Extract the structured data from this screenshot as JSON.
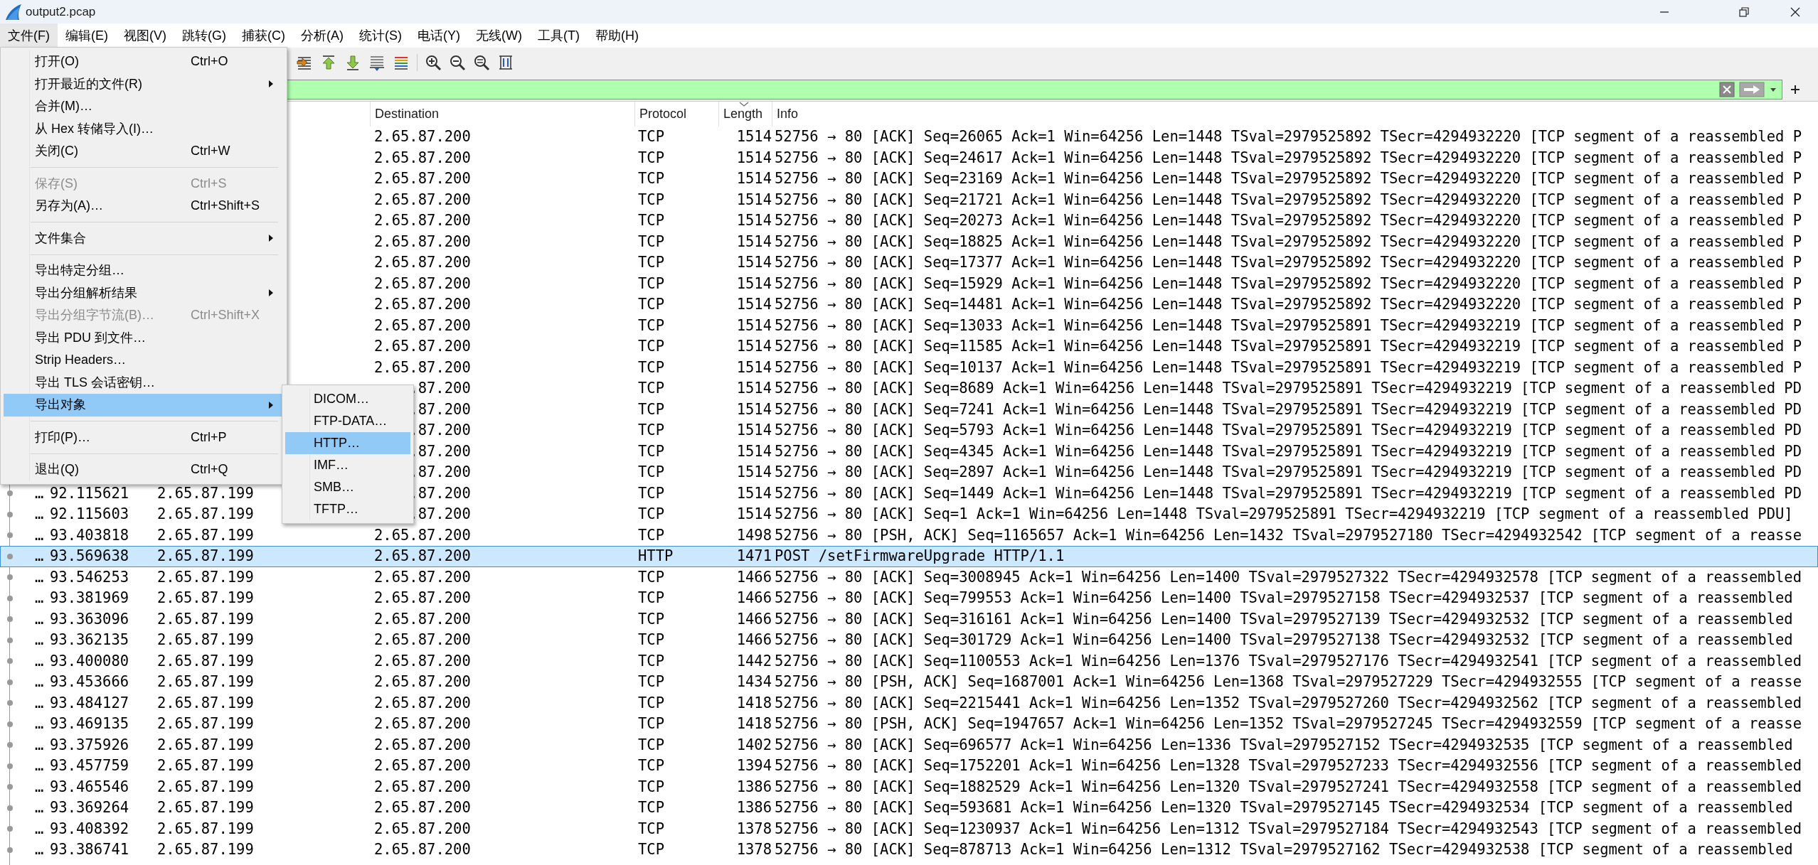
{
  "window": {
    "title": "output2.pcap"
  },
  "menu_bar": [
    {
      "label": "文件(F)",
      "selected": true
    },
    {
      "label": "编辑(E)",
      "selected": false
    },
    {
      "label": "视图(V)",
      "selected": false
    },
    {
      "label": "跳转(G)",
      "selected": false
    },
    {
      "label": "捕获(C)",
      "selected": false
    },
    {
      "label": "分析(A)",
      "selected": false
    },
    {
      "label": "统计(S)",
      "selected": false
    },
    {
      "label": "电话(Y)",
      "selected": false
    },
    {
      "label": "无线(W)",
      "selected": false
    },
    {
      "label": "工具(T)",
      "selected": false
    },
    {
      "label": "帮助(H)",
      "selected": false
    }
  ],
  "file_menu": {
    "items": [
      {
        "kind": "item",
        "label": "打开(O)",
        "shortcut": "Ctrl+O",
        "disabled": false,
        "has_submenu": false,
        "selected": false
      },
      {
        "kind": "item",
        "label": "打开最近的文件(R)",
        "disabled": false,
        "has_submenu": true,
        "selected": false
      },
      {
        "kind": "item",
        "label": "合并(M)…",
        "disabled": false,
        "has_submenu": false,
        "selected": false
      },
      {
        "kind": "item",
        "label": "从 Hex 转储导入(I)…",
        "disabled": false,
        "has_submenu": false,
        "selected": false
      },
      {
        "kind": "item",
        "label": "关闭(C)",
        "shortcut": "Ctrl+W",
        "disabled": false,
        "has_submenu": false,
        "selected": false
      },
      {
        "kind": "separator"
      },
      {
        "kind": "item",
        "label": "保存(S)",
        "shortcut": "Ctrl+S",
        "disabled": true,
        "has_submenu": false,
        "selected": false
      },
      {
        "kind": "item",
        "label": "另存为(A)…",
        "shortcut": "Ctrl+Shift+S",
        "disabled": false,
        "has_submenu": false,
        "selected": false
      },
      {
        "kind": "separator"
      },
      {
        "kind": "item",
        "label": "文件集合",
        "disabled": false,
        "has_submenu": true,
        "selected": false
      },
      {
        "kind": "separator"
      },
      {
        "kind": "item",
        "label": "导出特定分组…",
        "disabled": false,
        "has_submenu": false,
        "selected": false
      },
      {
        "kind": "item",
        "label": "导出分组解析结果",
        "disabled": false,
        "has_submenu": true,
        "selected": false
      },
      {
        "kind": "item",
        "label": "导出分组字节流(B)…",
        "shortcut": "Ctrl+Shift+X",
        "disabled": true,
        "has_submenu": false,
        "selected": false
      },
      {
        "kind": "item",
        "label": "导出 PDU 到文件…",
        "disabled": false,
        "has_submenu": false,
        "selected": false
      },
      {
        "kind": "item",
        "label": "Strip Headers…",
        "disabled": false,
        "has_submenu": false,
        "selected": false
      },
      {
        "kind": "item",
        "label": "导出 TLS 会话密钥…",
        "disabled": false,
        "has_submenu": false,
        "selected": false
      },
      {
        "kind": "item",
        "label": "导出对象",
        "disabled": false,
        "has_submenu": true,
        "selected": true
      },
      {
        "kind": "separator"
      },
      {
        "kind": "item",
        "label": "打印(P)…",
        "shortcut": "Ctrl+P",
        "disabled": false,
        "has_submenu": false,
        "selected": false
      },
      {
        "kind": "separator"
      },
      {
        "kind": "item",
        "label": "退出(Q)",
        "shortcut": "Ctrl+Q",
        "disabled": false,
        "has_submenu": false,
        "selected": false
      }
    ]
  },
  "export_objects_submenu": {
    "items": [
      {
        "label": "DICOM…",
        "selected": false
      },
      {
        "label": "FTP-DATA…",
        "selected": false
      },
      {
        "label": "HTTP…",
        "selected": true
      },
      {
        "label": "IMF…",
        "selected": false
      },
      {
        "label": "SMB…",
        "selected": false
      },
      {
        "label": "TFTP…",
        "selected": false
      }
    ]
  },
  "packet_list": {
    "columns": [
      {
        "label": "Destination",
        "sorted": false
      },
      {
        "label": "Protocol",
        "sorted": false
      },
      {
        "label": "Length",
        "sorted": true
      },
      {
        "label": "Info",
        "sorted": false
      }
    ],
    "rows": [
      {
        "destination": "2.65.87.200",
        "protocol": "TCP",
        "length": "1514",
        "info": "52756 → 80 [ACK] Seq=26065 Ack=1 Win=64256 Len=1448 TSval=2979525892 TSecr=4294932220 [TCP segment of a reassembled P",
        "selected": false
      },
      {
        "destination": "2.65.87.200",
        "protocol": "TCP",
        "length": "1514",
        "info": "52756 → 80 [ACK] Seq=24617 Ack=1 Win=64256 Len=1448 TSval=2979525892 TSecr=4294932220 [TCP segment of a reassembled P",
        "selected": false
      },
      {
        "destination": "2.65.87.200",
        "protocol": "TCP",
        "length": "1514",
        "info": "52756 → 80 [ACK] Seq=23169 Ack=1 Win=64256 Len=1448 TSval=2979525892 TSecr=4294932220 [TCP segment of a reassembled P",
        "selected": false
      },
      {
        "destination": "2.65.87.200",
        "protocol": "TCP",
        "length": "1514",
        "info": "52756 → 80 [ACK] Seq=21721 Ack=1 Win=64256 Len=1448 TSval=2979525892 TSecr=4294932220 [TCP segment of a reassembled P",
        "selected": false
      },
      {
        "destination": "2.65.87.200",
        "protocol": "TCP",
        "length": "1514",
        "info": "52756 → 80 [ACK] Seq=20273 Ack=1 Win=64256 Len=1448 TSval=2979525892 TSecr=4294932220 [TCP segment of a reassembled P",
        "selected": false
      },
      {
        "destination": "2.65.87.200",
        "protocol": "TCP",
        "length": "1514",
        "info": "52756 → 80 [ACK] Seq=18825 Ack=1 Win=64256 Len=1448 TSval=2979525892 TSecr=4294932220 [TCP segment of a reassembled P",
        "selected": false
      },
      {
        "destination": "2.65.87.200",
        "protocol": "TCP",
        "length": "1514",
        "info": "52756 → 80 [ACK] Seq=17377 Ack=1 Win=64256 Len=1448 TSval=2979525892 TSecr=4294932220 [TCP segment of a reassembled P",
        "selected": false
      },
      {
        "destination": "2.65.87.200",
        "protocol": "TCP",
        "length": "1514",
        "info": "52756 → 80 [ACK] Seq=15929 Ack=1 Win=64256 Len=1448 TSval=2979525892 TSecr=4294932220 [TCP segment of a reassembled P",
        "selected": false
      },
      {
        "destination": "2.65.87.200",
        "protocol": "TCP",
        "length": "1514",
        "info": "52756 → 80 [ACK] Seq=14481 Ack=1 Win=64256 Len=1448 TSval=2979525892 TSecr=4294932220 [TCP segment of a reassembled P",
        "selected": false
      },
      {
        "destination": "2.65.87.200",
        "protocol": "TCP",
        "length": "1514",
        "info": "52756 → 80 [ACK] Seq=13033 Ack=1 Win=64256 Len=1448 TSval=2979525891 TSecr=4294932219 [TCP segment of a reassembled P",
        "selected": false
      },
      {
        "destination": "2.65.87.200",
        "protocol": "TCP",
        "length": "1514",
        "info": "52756 → 80 [ACK] Seq=11585 Ack=1 Win=64256 Len=1448 TSval=2979525891 TSecr=4294932219 [TCP segment of a reassembled P",
        "selected": false
      },
      {
        "destination": "2.65.87.200",
        "protocol": "TCP",
        "length": "1514",
        "info": "52756 → 80 [ACK] Seq=10137 Ack=1 Win=64256 Len=1448 TSval=2979525891 TSecr=4294932219 [TCP segment of a reassembled P",
        "selected": false
      },
      {
        "destination": ".87.200",
        "protocol": "TCP",
        "length": "1514",
        "info": "52756 → 80 [ACK] Seq=8689 Ack=1 Win=64256 Len=1448 TSval=2979525891 TSecr=4294932219 [TCP segment of a reassembled PD",
        "selected": false
      },
      {
        "destination": ".87.200",
        "protocol": "TCP",
        "length": "1514",
        "info": "52756 → 80 [ACK] Seq=7241 Ack=1 Win=64256 Len=1448 TSval=2979525891 TSecr=4294932219 [TCP segment of a reassembled PD",
        "selected": false
      },
      {
        "destination": ".87.200",
        "protocol": "TCP",
        "length": "1514",
        "info": "52756 → 80 [ACK] Seq=5793 Ack=1 Win=64256 Len=1448 TSval=2979525891 TSecr=4294932219 [TCP segment of a reassembled PD",
        "selected": false
      },
      {
        "destination": ".87.200",
        "protocol": "TCP",
        "length": "1514",
        "info": "52756 → 80 [ACK] Seq=4345 Ack=1 Win=64256 Len=1448 TSval=2979525891 TSecr=4294932219 [TCP segment of a reassembled PD",
        "selected": false
      },
      {
        "destination": ".87.200",
        "protocol": "TCP",
        "length": "1514",
        "info": "52756 → 80 [ACK] Seq=2897 Ack=1 Win=64256 Len=1448 TSval=2979525891 TSecr=4294932219 [TCP segment of a reassembled PD",
        "selected": false
      },
      {
        "no": "…",
        "time": "92.115621",
        "source": "2.65.87.199",
        "destination": ".87.200",
        "protocol": "TCP",
        "length": "1514",
        "info": "52756 → 80 [ACK] Seq=1449 Ack=1 Win=64256 Len=1448 TSval=2979525891 TSecr=4294932219 [TCP segment of a reassembled PD",
        "selected": false
      },
      {
        "no": "…",
        "time": "92.115603",
        "source": "2.65.87.199",
        "destination": ".87.200",
        "protocol": "TCP",
        "length": "1514",
        "info": "52756 → 80 [ACK] Seq=1 Ack=1 Win=64256 Len=1448 TSval=2979525891 TSecr=4294932219 [TCP segment of a reassembled PDU]",
        "selected": false
      },
      {
        "no": "…",
        "time": "93.403818",
        "source": "2.65.87.199",
        "destination": "2.65.87.200",
        "protocol": "TCP",
        "length": "1498",
        "info": "52756 → 80 [PSH, ACK] Seq=1165657 Ack=1 Win=64256 Len=1432 TSval=2979527180 TSecr=4294932542 [TCP segment of a reasse",
        "selected": false
      },
      {
        "no": "…",
        "time": "93.569638",
        "source": "2.65.87.199",
        "destination": "2.65.87.200",
        "protocol": "HTTP",
        "length": "1471",
        "info": "POST /setFirmwareUpgrade HTTP/1.1",
        "selected": true
      },
      {
        "no": "…",
        "time": "93.546253",
        "source": "2.65.87.199",
        "destination": "2.65.87.200",
        "protocol": "TCP",
        "length": "1466",
        "info": "52756 → 80 [ACK] Seq=3008945 Ack=1 Win=64256 Len=1400 TSval=2979527322 TSecr=4294932578 [TCP segment of a reassembled",
        "selected": false
      },
      {
        "no": "…",
        "time": "93.381969",
        "source": "2.65.87.199",
        "destination": "2.65.87.200",
        "protocol": "TCP",
        "length": "1466",
        "info": "52756 → 80 [ACK] Seq=799553 Ack=1 Win=64256 Len=1400 TSval=2979527158 TSecr=4294932537 [TCP segment of a reassembled",
        "selected": false
      },
      {
        "no": "…",
        "time": "93.363096",
        "source": "2.65.87.199",
        "destination": "2.65.87.200",
        "protocol": "TCP",
        "length": "1466",
        "info": "52756 → 80 [ACK] Seq=316161 Ack=1 Win=64256 Len=1400 TSval=2979527139 TSecr=4294932532 [TCP segment of a reassembled",
        "selected": false
      },
      {
        "no": "…",
        "time": "93.362135",
        "source": "2.65.87.199",
        "destination": "2.65.87.200",
        "protocol": "TCP",
        "length": "1466",
        "info": "52756 → 80 [ACK] Seq=301729 Ack=1 Win=64256 Len=1400 TSval=2979527138 TSecr=4294932532 [TCP segment of a reassembled",
        "selected": false
      },
      {
        "no": "…",
        "time": "93.400080",
        "source": "2.65.87.199",
        "destination": "2.65.87.200",
        "protocol": "TCP",
        "length": "1442",
        "info": "52756 → 80 [ACK] Seq=1100553 Ack=1 Win=64256 Len=1376 TSval=2979527176 TSecr=4294932541 [TCP segment of a reassembled",
        "selected": false
      },
      {
        "no": "…",
        "time": "93.453666",
        "source": "2.65.87.199",
        "destination": "2.65.87.200",
        "protocol": "TCP",
        "length": "1434",
        "info": "52756 → 80 [PSH, ACK] Seq=1687001 Ack=1 Win=64256 Len=1368 TSval=2979527229 TSecr=4294932555 [TCP segment of a reasse",
        "selected": false
      },
      {
        "no": "…",
        "time": "93.484127",
        "source": "2.65.87.199",
        "destination": "2.65.87.200",
        "protocol": "TCP",
        "length": "1418",
        "info": "52756 → 80 [ACK] Seq=2215441 Ack=1 Win=64256 Len=1352 TSval=2979527260 TSecr=4294932562 [TCP segment of a reassembled",
        "selected": false
      },
      {
        "no": "…",
        "time": "93.469135",
        "source": "2.65.87.199",
        "destination": "2.65.87.200",
        "protocol": "TCP",
        "length": "1418",
        "info": "52756 → 80 [PSH, ACK] Seq=1947657 Ack=1 Win=64256 Len=1352 TSval=2979527245 TSecr=4294932559 [TCP segment of a reasse",
        "selected": false
      },
      {
        "no": "…",
        "time": "93.375926",
        "source": "2.65.87.199",
        "destination": "2.65.87.200",
        "protocol": "TCP",
        "length": "1402",
        "info": "52756 → 80 [ACK] Seq=696577 Ack=1 Win=64256 Len=1336 TSval=2979527152 TSecr=4294932535 [TCP segment of a reassembled",
        "selected": false
      },
      {
        "no": "…",
        "time": "93.457759",
        "source": "2.65.87.199",
        "destination": "2.65.87.200",
        "protocol": "TCP",
        "length": "1394",
        "info": "52756 → 80 [ACK] Seq=1752201 Ack=1 Win=64256 Len=1328 TSval=2979527233 TSecr=4294932556 [TCP segment of a reassembled",
        "selected": false
      },
      {
        "no": "…",
        "time": "93.465546",
        "source": "2.65.87.199",
        "destination": "2.65.87.200",
        "protocol": "TCP",
        "length": "1386",
        "info": "52756 → 80 [ACK] Seq=1882529 Ack=1 Win=64256 Len=1320 TSval=2979527241 TSecr=4294932558 [TCP segment of a reassembled",
        "selected": false
      },
      {
        "no": "…",
        "time": "93.369264",
        "source": "2.65.87.199",
        "destination": "2.65.87.200",
        "protocol": "TCP",
        "length": "1386",
        "info": "52756 → 80 [ACK] Seq=593681 Ack=1 Win=64256 Len=1320 TSval=2979527145 TSecr=4294932534 [TCP segment of a reassembled",
        "selected": false
      },
      {
        "no": "…",
        "time": "93.408392",
        "source": "2.65.87.199",
        "destination": "2.65.87.200",
        "protocol": "TCP",
        "length": "1378",
        "info": "52756 → 80 [ACK] Seq=1230937 Ack=1 Win=64256 Len=1312 TSval=2979527184 TSecr=4294932543 [TCP segment of a reassembled",
        "selected": false
      },
      {
        "no": "…",
        "time": "93.386741",
        "source": "2.65.87.199",
        "destination": "2.65.87.200",
        "protocol": "TCP",
        "length": "1378",
        "info": "52756 → 80 [ACK] Seq=878713 Ack=1 Win=64256 Len=1312 TSval=2979527162 TSecr=4294932538 [TCP segment of a reassembled",
        "selected": false
      }
    ]
  }
}
